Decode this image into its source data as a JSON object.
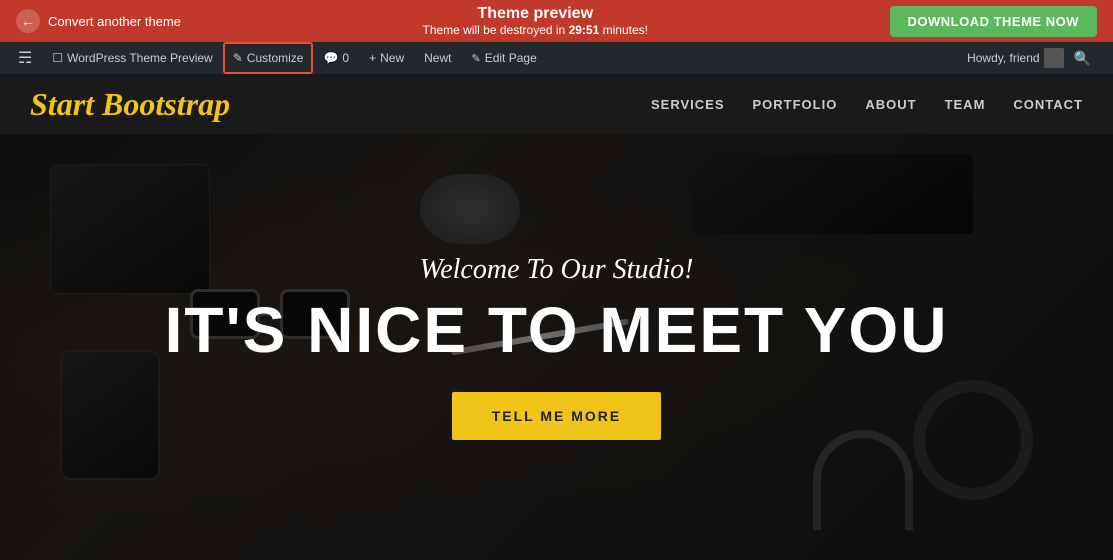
{
  "banner": {
    "back_label": "Convert another theme",
    "title": "Theme preview",
    "subtitle": "Theme will be destroyed in",
    "countdown": "29:51",
    "countdown_suffix": " minutes!",
    "download_label": "DOWNLOAD THEME NOW"
  },
  "admin_bar": {
    "wp_label": "WordPress Theme Preview",
    "customize_label": "Customize",
    "comments_label": "0",
    "new_label": "New",
    "newt_label": "Newt",
    "edit_label": "Edit Page",
    "howdy_label": "Howdy, friend"
  },
  "header": {
    "logo": "Start Bootstrap",
    "nav": [
      {
        "label": "SERVICES"
      },
      {
        "label": "PORTFOLIO"
      },
      {
        "label": "ABOUT"
      },
      {
        "label": "TEAM"
      },
      {
        "label": "CONTACT"
      }
    ]
  },
  "hero": {
    "subtitle": "Welcome To Our Studio!",
    "title": "IT'S NICE TO MEET YOU",
    "cta_label": "TELL ME MORE"
  }
}
